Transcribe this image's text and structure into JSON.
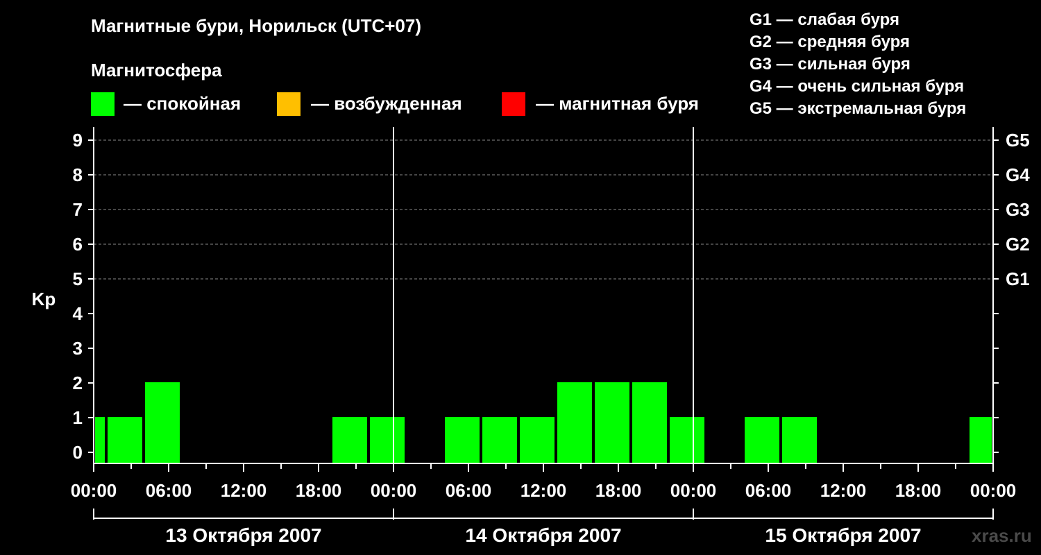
{
  "title": "Магнитные бури, Норильск (UTC+07)",
  "magnetosphere": {
    "heading": "Магнитосфера",
    "legend": [
      {
        "label": "— спокойная",
        "color": "#00ff00"
      },
      {
        "label": "— возбужденная",
        "color": "#ffbf00"
      },
      {
        "label": "— магнитная буря",
        "color": "#ff0000"
      }
    ]
  },
  "storm_levels": [
    "G1 — слабая буря",
    "G2 — средняя буря",
    "G3 — сильная буря",
    "G4 — очень сильная буря",
    "G5 — экстремальная буря"
  ],
  "watermark": "xras.ru",
  "chart_data": {
    "type": "bar",
    "ylabel": "Kp",
    "ylim": [
      0,
      9
    ],
    "yticks": [
      "0",
      "1",
      "2",
      "3",
      "4",
      "5",
      "6",
      "7",
      "8",
      "9"
    ],
    "right_ticks": [
      {
        "kp": 5,
        "label": "G1"
      },
      {
        "kp": 6,
        "label": "G2"
      },
      {
        "kp": 7,
        "label": "G3"
      },
      {
        "kp": 8,
        "label": "G4"
      },
      {
        "kp": 9,
        "label": "G5"
      }
    ],
    "xticks": [
      "00:00",
      "06:00",
      "12:00",
      "18:00",
      "00:00",
      "06:00",
      "12:00",
      "18:00",
      "00:00",
      "06:00",
      "12:00",
      "18:00",
      "00:00"
    ],
    "days": [
      "13 Октября 2007",
      "14 Октября 2007",
      "15 Октября 2007"
    ],
    "x_unit": "hours from 13 Oct 2007 00:00 (UTC+07)",
    "bars": [
      {
        "start": 0,
        "end": 1,
        "kp": 1,
        "color": "#00ff00"
      },
      {
        "start": 1,
        "end": 4,
        "kp": 1,
        "color": "#00ff00"
      },
      {
        "start": 4,
        "end": 7,
        "kp": 2,
        "color": "#00ff00"
      },
      {
        "start": 19,
        "end": 22,
        "kp": 1,
        "color": "#00ff00"
      },
      {
        "start": 22,
        "end": 25,
        "kp": 1,
        "color": "#00ff00"
      },
      {
        "start": 28,
        "end": 31,
        "kp": 1,
        "color": "#00ff00"
      },
      {
        "start": 31,
        "end": 34,
        "kp": 1,
        "color": "#00ff00"
      },
      {
        "start": 34,
        "end": 37,
        "kp": 1,
        "color": "#00ff00"
      },
      {
        "start": 37,
        "end": 40,
        "kp": 2,
        "color": "#00ff00"
      },
      {
        "start": 40,
        "end": 43,
        "kp": 2,
        "color": "#00ff00"
      },
      {
        "start": 43,
        "end": 46,
        "kp": 2,
        "color": "#00ff00"
      },
      {
        "start": 46,
        "end": 49,
        "kp": 1,
        "color": "#00ff00"
      },
      {
        "start": 52,
        "end": 55,
        "kp": 1,
        "color": "#00ff00"
      },
      {
        "start": 55,
        "end": 58,
        "kp": 1,
        "color": "#00ff00"
      },
      {
        "start": 70,
        "end": 72,
        "kp": 1,
        "color": "#00ff00"
      }
    ],
    "grid": "dashed at Kp 5–9"
  }
}
